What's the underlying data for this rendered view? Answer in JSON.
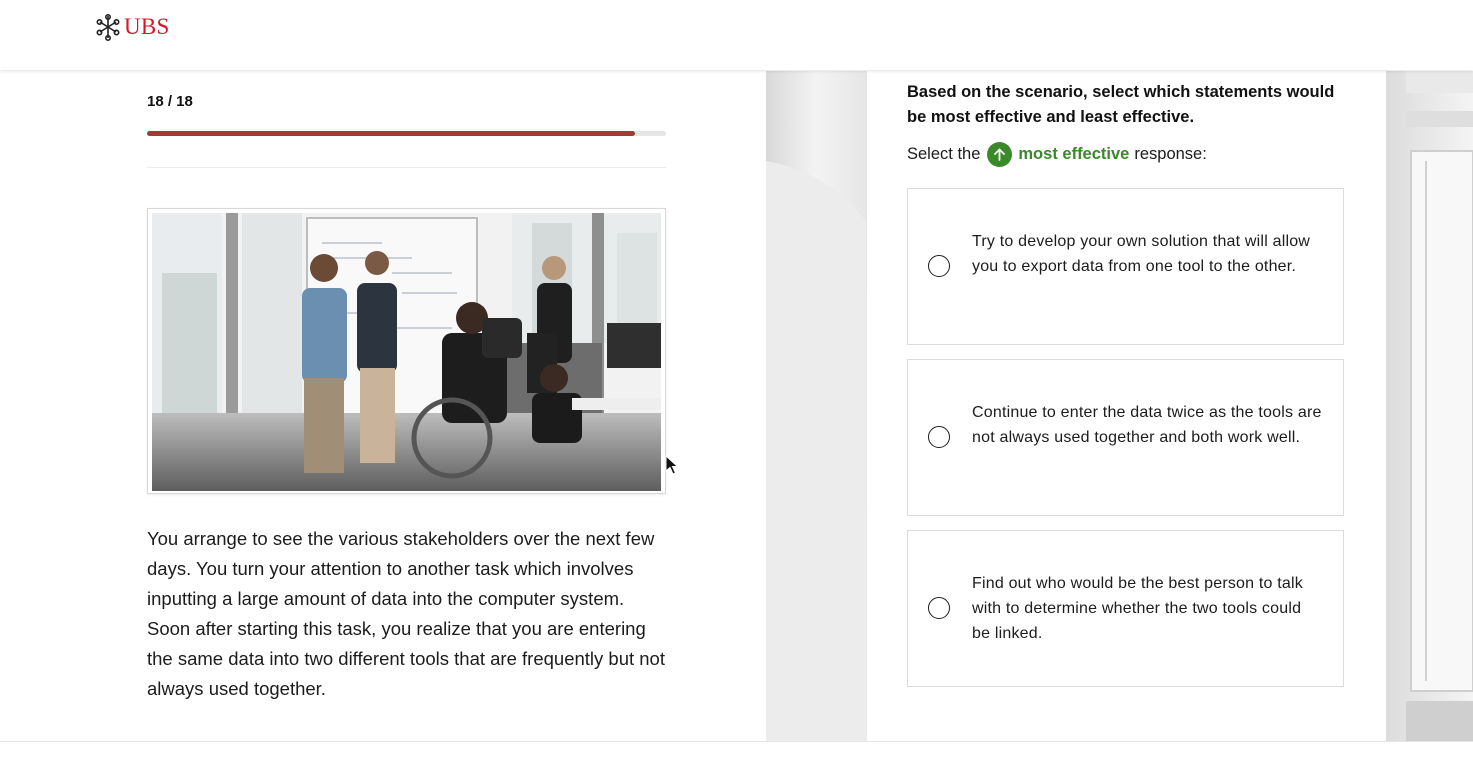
{
  "header": {
    "logo_text": "UBS"
  },
  "progress": {
    "counter": "18 / 18",
    "fraction": 0.94
  },
  "scenario": {
    "text": "You arrange to see the various stakeholders over the next few days. You turn your attention to another task which involves inputting a large amount of data into the computer system. Soon after starting this task, you realize that you are entering the same data into two different tools that are frequently but not always used together."
  },
  "question": {
    "prompt": "Based on the scenario, select which statements would be most effective and least effective.",
    "instruction_prefix": "Select the",
    "instruction_highlight": "most effective",
    "instruction_suffix": "response:",
    "highlight_color": "#3a8a2a",
    "badge_icon": "arrow-up-icon"
  },
  "options": [
    {
      "text": "Try to develop your own solution that will allow you to export data from one tool to the other.",
      "selected": false
    },
    {
      "text": "Continue to enter the data twice as the tools are not always used together and both work well.",
      "selected": false
    },
    {
      "text": "Find out who would be the best person to talk with to determine whether the two tools could be linked.",
      "selected": false
    }
  ],
  "colors": {
    "brand_red": "#d1192a",
    "progress_fill": "#a43a33"
  }
}
